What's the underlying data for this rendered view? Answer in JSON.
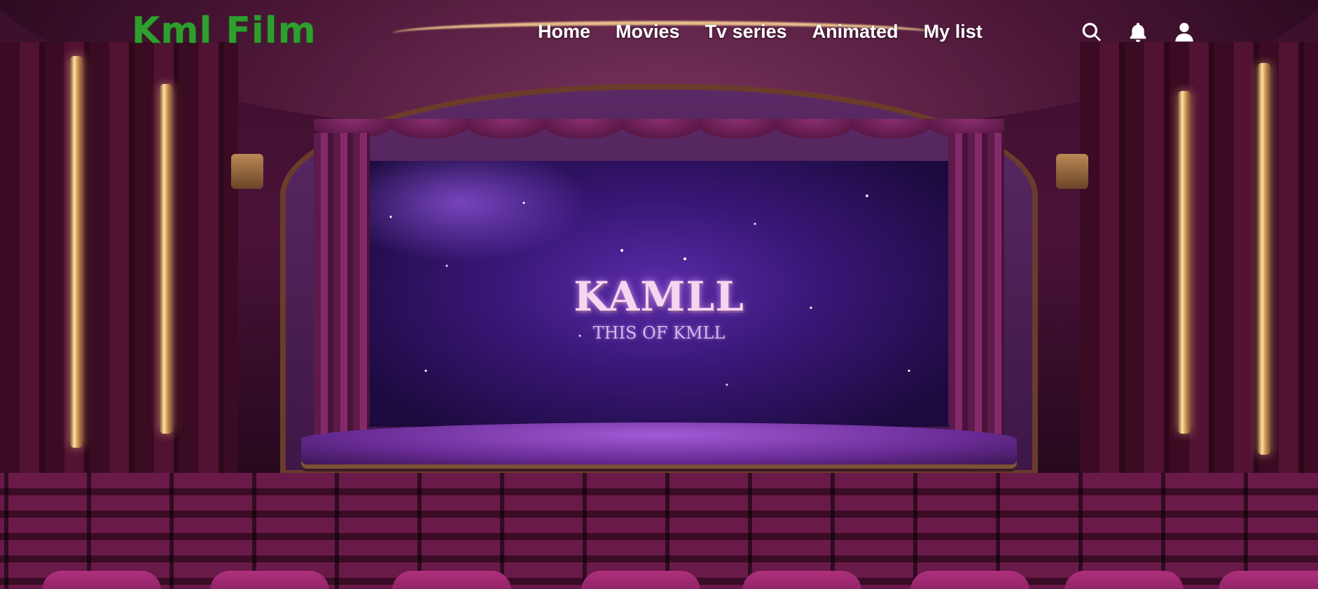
{
  "header": {
    "logo": "Kml Film",
    "nav": [
      {
        "label": "Home"
      },
      {
        "label": "Movies"
      },
      {
        "label": "Tv series"
      },
      {
        "label": "Animated"
      },
      {
        "label": "My list"
      }
    ],
    "icons": [
      "search-icon",
      "bell-icon",
      "user-icon"
    ]
  },
  "hero": {
    "screen_title": "KAMLL",
    "screen_subtitle": "THIS OF KMLL"
  },
  "colors": {
    "logo": "#2e9f2e",
    "nav_text": "#ffffff",
    "screen": "#3a1778"
  }
}
